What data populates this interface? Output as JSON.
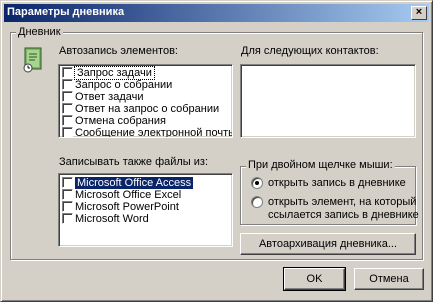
{
  "window": {
    "title": "Параметры дневника",
    "close_glyph": "×"
  },
  "journal_group": {
    "label": "Дневник"
  },
  "auto_record": {
    "label": "Автозапись элементов:",
    "items": [
      "Запрос задачи",
      "Запрос о собрании",
      "Ответ задачи",
      "Ответ на запрос о собрании",
      "Отмена собрания",
      "Сообщение электронной почты"
    ]
  },
  "contacts": {
    "label": "Для следующих контактов:"
  },
  "files": {
    "label": "Записывать также файлы из:",
    "items": [
      "Microsoft Office Access",
      "Microsoft Office Excel",
      "Microsoft PowerPoint",
      "Microsoft Word"
    ]
  },
  "double_click": {
    "label": "При двойном щелчке мыши:",
    "options": [
      "открыть запись в дневнике",
      "открыть элемент, на который",
      "ссылается запись в дневнике"
    ],
    "selected_index": 0
  },
  "buttons": {
    "archive": "Автоархивация дневника...",
    "ok": "OK",
    "cancel": "Отмена"
  },
  "colors": {
    "face": "#d4d0c8",
    "title_start": "#0a246a",
    "title_end": "#a6caf0",
    "selection": "#0a246a"
  },
  "icons": {
    "journal": "journal-book-icon",
    "close": "close-icon"
  }
}
